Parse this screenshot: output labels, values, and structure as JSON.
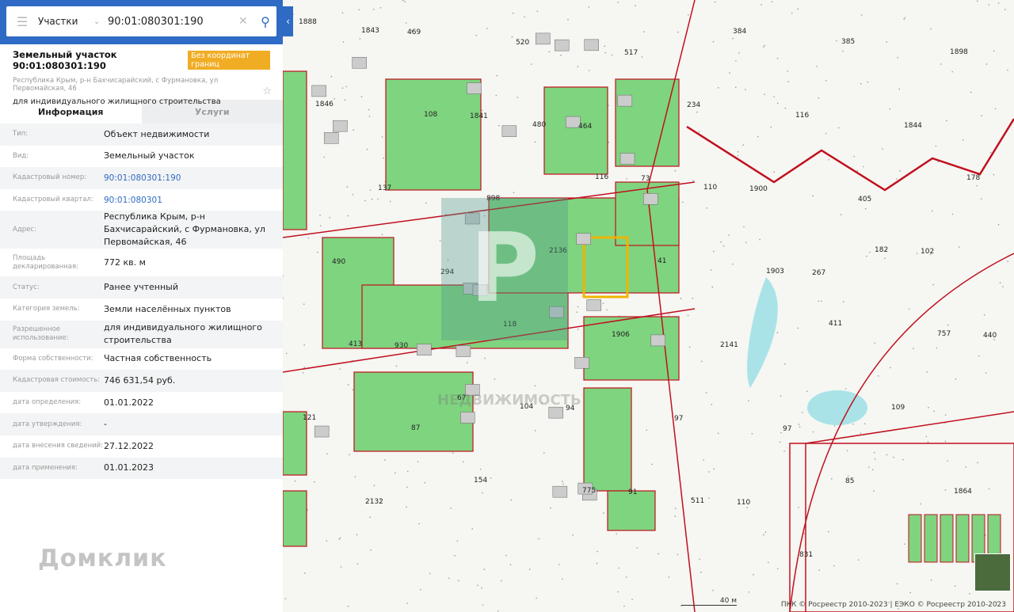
{
  "search": {
    "type": "Участки",
    "query": "90:01:080301:190"
  },
  "header": {
    "title": "Земельный участок 90:01:080301:190",
    "badge": "Без координат границ",
    "address": "Республика Крым, р-н Бахчисарайский, с Фурмановка, ул Первомайская, 46",
    "purpose": "для индивидуального жилищного строительства"
  },
  "tabs": [
    {
      "label": "Информация"
    },
    {
      "label": "Услуги"
    }
  ],
  "info": [
    {
      "label": "Тип:",
      "value": "Объект недвижимости"
    },
    {
      "label": "Вид:",
      "value": "Земельный участок"
    },
    {
      "label": "Кадастровый номер:",
      "value": "90:01:080301:190"
    },
    {
      "label": "Кадастровый квартал:",
      "value": "90:01:080301"
    },
    {
      "label": "Адрес:",
      "value": "Республика Крым, р-н Бахчисарайский, с Фурмановка, ул Первомайская, 46"
    },
    {
      "label": "Площадь декларированная:",
      "value": "772 кв. м"
    },
    {
      "label": "Статус:",
      "value": "Ранее учтенный"
    },
    {
      "label": "Категория земель:",
      "value": "Земли населённых пунктов"
    },
    {
      "label": "Разрешенное использование:",
      "value": "для индивидуального жилищного строительства"
    },
    {
      "label": "Форма собственности:",
      "value": "Частная собственность"
    },
    {
      "label": "Кадастровая стоимость:",
      "value": "746 631,54 руб."
    },
    {
      "label": "дата определения:",
      "value": "01.01.2022"
    },
    {
      "label": "дата утверждения:",
      "value": "-"
    },
    {
      "label": "дата внесения сведений:",
      "value": "27.12.2022"
    },
    {
      "label": "дата применения:",
      "value": "01.01.2023"
    }
  ],
  "logo": "Домклик",
  "map": {
    "scale": "40 м",
    "attribution": "ПКК © Росреестр 2010-2023 | ЕЭКО © Росреестр 2010-2023",
    "watermark": "Р",
    "watermark_text": "НЕДВИЖИМОСТЬ",
    "labels": [
      "1888",
      "469",
      "520",
      "517",
      "384",
      "385",
      "1898",
      "1843",
      "1841",
      "464",
      "234",
      "116",
      "1844",
      "1846",
      "108",
      "480",
      "73",
      "1900",
      "405",
      "178",
      "137",
      "898",
      "116",
      "110",
      "267",
      "102",
      "490",
      "294",
      "2136",
      "41",
      "1903",
      "182",
      "440",
      "930",
      "118",
      "1906",
      "2141",
      "411",
      "757",
      "413",
      "67",
      "94",
      "97",
      "97",
      "109",
      "121",
      "87",
      "104",
      "91",
      "110",
      "85",
      "1864",
      "2132",
      "154",
      "775",
      "511",
      "831"
    ]
  },
  "colors": {
    "accent": "#2f6bc4",
    "badge": "#f0ad24",
    "parcel": "#7fd47f",
    "border": "#c0101e"
  }
}
